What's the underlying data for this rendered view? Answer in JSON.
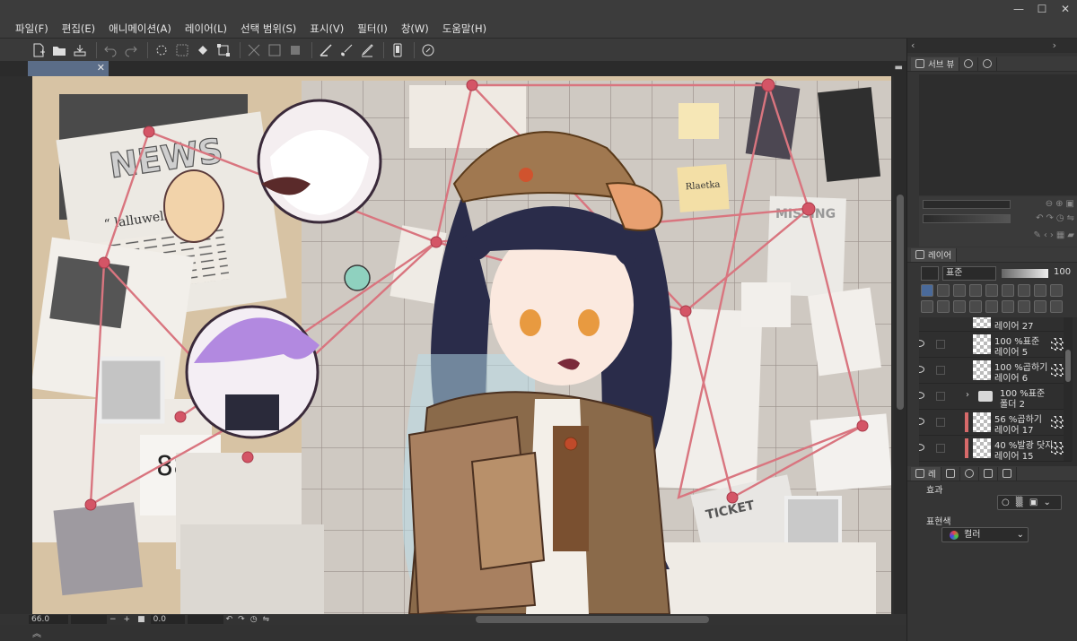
{
  "menu": [
    "파일(F)",
    "편집(E)",
    "애니메이션(A)",
    "레이어(L)",
    "선택 범위(S)",
    "표시(V)",
    "필터(I)",
    "창(W)",
    "도움말(H)"
  ],
  "window_controls": [
    "—",
    "☐",
    "✕"
  ],
  "doc_tab": {
    "close": "✕"
  },
  "status": {
    "zoom": "66.0",
    "angle": "0.0"
  },
  "right_panel": {
    "top_tabs": {
      "subview": "서브 뷰"
    },
    "layer_tab": "레이어",
    "blend_mode": "표준",
    "opacity": "100",
    "layers": [
      {
        "line1": "레이어 27",
        "line2": "",
        "kind": "partial"
      },
      {
        "line1": "100 %표준",
        "line2": "레이어 5",
        "kind": "raster"
      },
      {
        "line1": "100 %곱하기",
        "line2": "레이어 6",
        "kind": "raster"
      },
      {
        "line1": "100 %표준",
        "line2": "폴더 2",
        "kind": "folder"
      },
      {
        "line1": "56 %곱하기",
        "line2": "레이어 17",
        "kind": "raster_marked"
      },
      {
        "line1": "40 %발광 닷지",
        "line2": "레이어 15",
        "kind": "raster_marked"
      }
    ],
    "props_tab_label": "레",
    "effect_label": "효과",
    "expression_color_label": "표현색",
    "expression_color_value": "컬러"
  },
  "artwork": {
    "newspaper_headline": "NEWS",
    "newspaper_quote": "“ lalluwell",
    "poster_label": "MISSING",
    "ticket_label": "TICKET",
    "sticky_note": "Rlaetka"
  },
  "colors": {
    "canvas_bg": "#d7c3a4",
    "string_red": "#d9757f",
    "accent_tab": "#5b6d88"
  }
}
